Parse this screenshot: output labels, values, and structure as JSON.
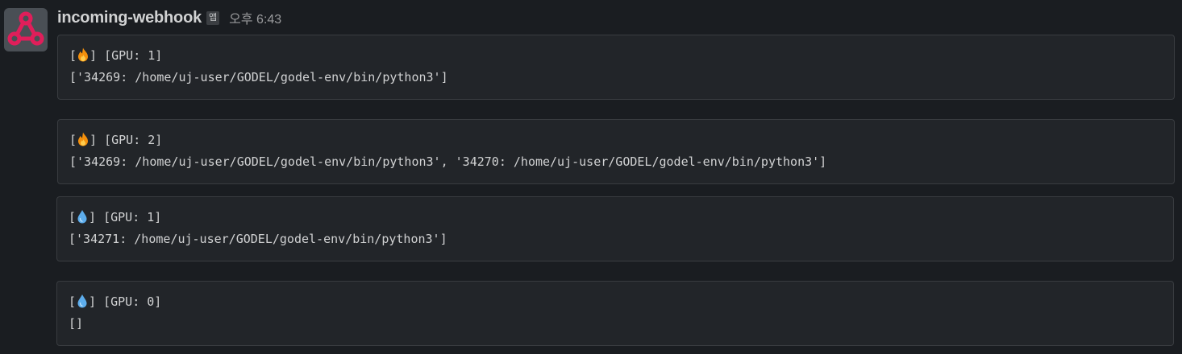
{
  "message": {
    "sender": "incoming-webhook",
    "badge": "앱",
    "timestamp": "오후 6:43"
  },
  "attachments": [
    {
      "icon": "fire-emoji",
      "bracket_open": "[",
      "bracket_close": "]",
      "status": " [GPU: 1]",
      "processes": "['34269: /home/uj-user/GODEL/godel-env/bin/python3']"
    },
    {
      "icon": "fire-emoji",
      "bracket_open": "[",
      "bracket_close": "]",
      "status": " [GPU: 2]",
      "processes": "['34269: /home/uj-user/GODEL/godel-env/bin/python3', '34270: /home/uj-user/GODEL/godel-env/bin/python3']"
    },
    {
      "icon": "droplet-emoji",
      "bracket_open": "[",
      "bracket_close": "]",
      "status": " [GPU: 1]",
      "processes": "['34271: /home/uj-user/GODEL/godel-env/bin/python3']"
    },
    {
      "icon": "droplet-emoji",
      "bracket_open": "[",
      "bracket_close": "]",
      "status": " [GPU: 0]",
      "processes": "[]"
    }
  ],
  "colors": {
    "background": "#1a1d21",
    "attachment_bg": "#222529",
    "attachment_border": "#393c40",
    "text": "#d1d2d3",
    "timestamp": "#9a9b9d",
    "avatar_logo": "#e01e5a",
    "fire": "#f4900c",
    "droplet": "#5dadec"
  }
}
